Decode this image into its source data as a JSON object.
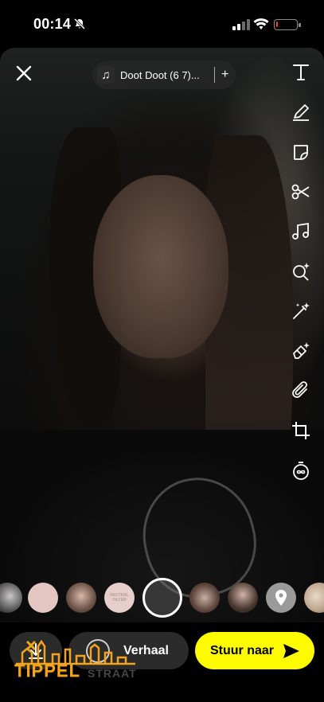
{
  "status_bar": {
    "time": "00:14",
    "battery_percent": 10,
    "battery_color": "#ff3b30"
  },
  "music": {
    "title": "Doot Doot (6 7)...",
    "add_label": "+"
  },
  "tools": [
    "text-icon",
    "pencil-icon",
    "sticker-icon",
    "scissors-icon",
    "music-note-icon",
    "search-sparkle-icon",
    "magic-wand-icon",
    "eraser-sparkle-icon",
    "paperclip-icon",
    "crop-icon",
    "timer-infinity-icon"
  ],
  "lenses": [
    {
      "name": "lens-portrait-1"
    },
    {
      "name": "lens-pink-solid"
    },
    {
      "name": "lens-portrait-2"
    },
    {
      "name": "lens-neutral-filter",
      "label": "NEUTRAL FILTER"
    },
    {
      "name": "lens-eye-closeup"
    },
    {
      "name": "lens-portrait-3"
    },
    {
      "name": "lens-location-pin"
    },
    {
      "name": "lens-portrait-4"
    }
  ],
  "bottom": {
    "story_label": "Verhaal",
    "send_label": "Stuur naar"
  },
  "watermark": {
    "text": "TIPPEL",
    "subtext": "STRAAT"
  },
  "colors": {
    "accent": "#fffc00",
    "watermark": "#f2a51a"
  }
}
